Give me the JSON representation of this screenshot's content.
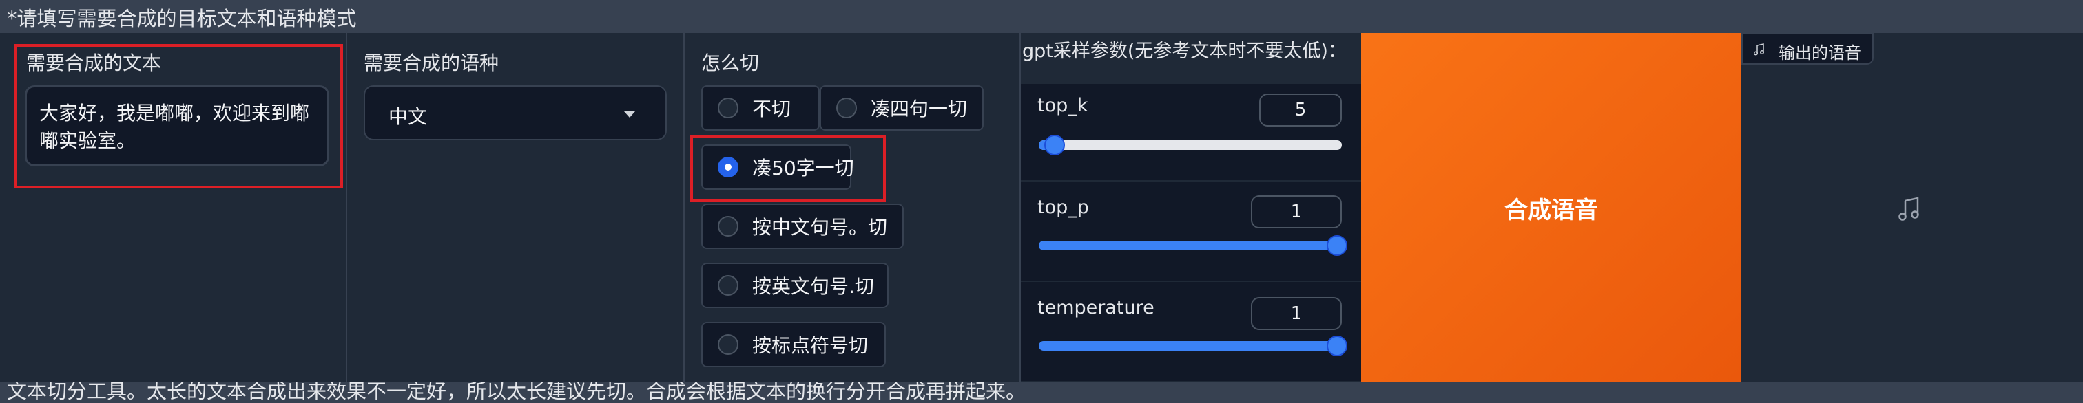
{
  "header": {
    "title": "*请填写需要合成的目标文本和语种模式"
  },
  "text_panel": {
    "label": "需要合成的文本",
    "value": "大家好，我是嘟嘟，欢迎来到嘟嘟实验室。"
  },
  "lang_panel": {
    "label": "需要合成的语种",
    "selected": "中文"
  },
  "cut_panel": {
    "label": "怎么切",
    "options": [
      "不切",
      "凑四句一切",
      "凑50字一切",
      "按中文句号。切",
      "按英文句号.切",
      "按标点符号切"
    ],
    "selected": "凑50字一切"
  },
  "gpt_params": {
    "title": "gpt采样参数(无参考文本时不要太低)：",
    "top_k": {
      "label": "top_k",
      "value": "5",
      "level": 0.05
    },
    "top_p": {
      "label": "top_p",
      "value": "1",
      "level": 1.0
    },
    "temperature": {
      "label": "temperature",
      "value": "1",
      "level": 1.0
    }
  },
  "synthesize_button": {
    "label": "合成语音"
  },
  "output_audio": {
    "label": "输出的语音",
    "icon": "music-note-icon"
  },
  "footer": {
    "text": "文本切分工具。太长的文本合成出来效果不一定好，所以太长建议先切。合成会根据文本的换行分开合成再拼起来。"
  },
  "colors": {
    "accent": "#f97316",
    "selected_radio": "#2563eb",
    "highlight_box": "#dc1f26"
  }
}
